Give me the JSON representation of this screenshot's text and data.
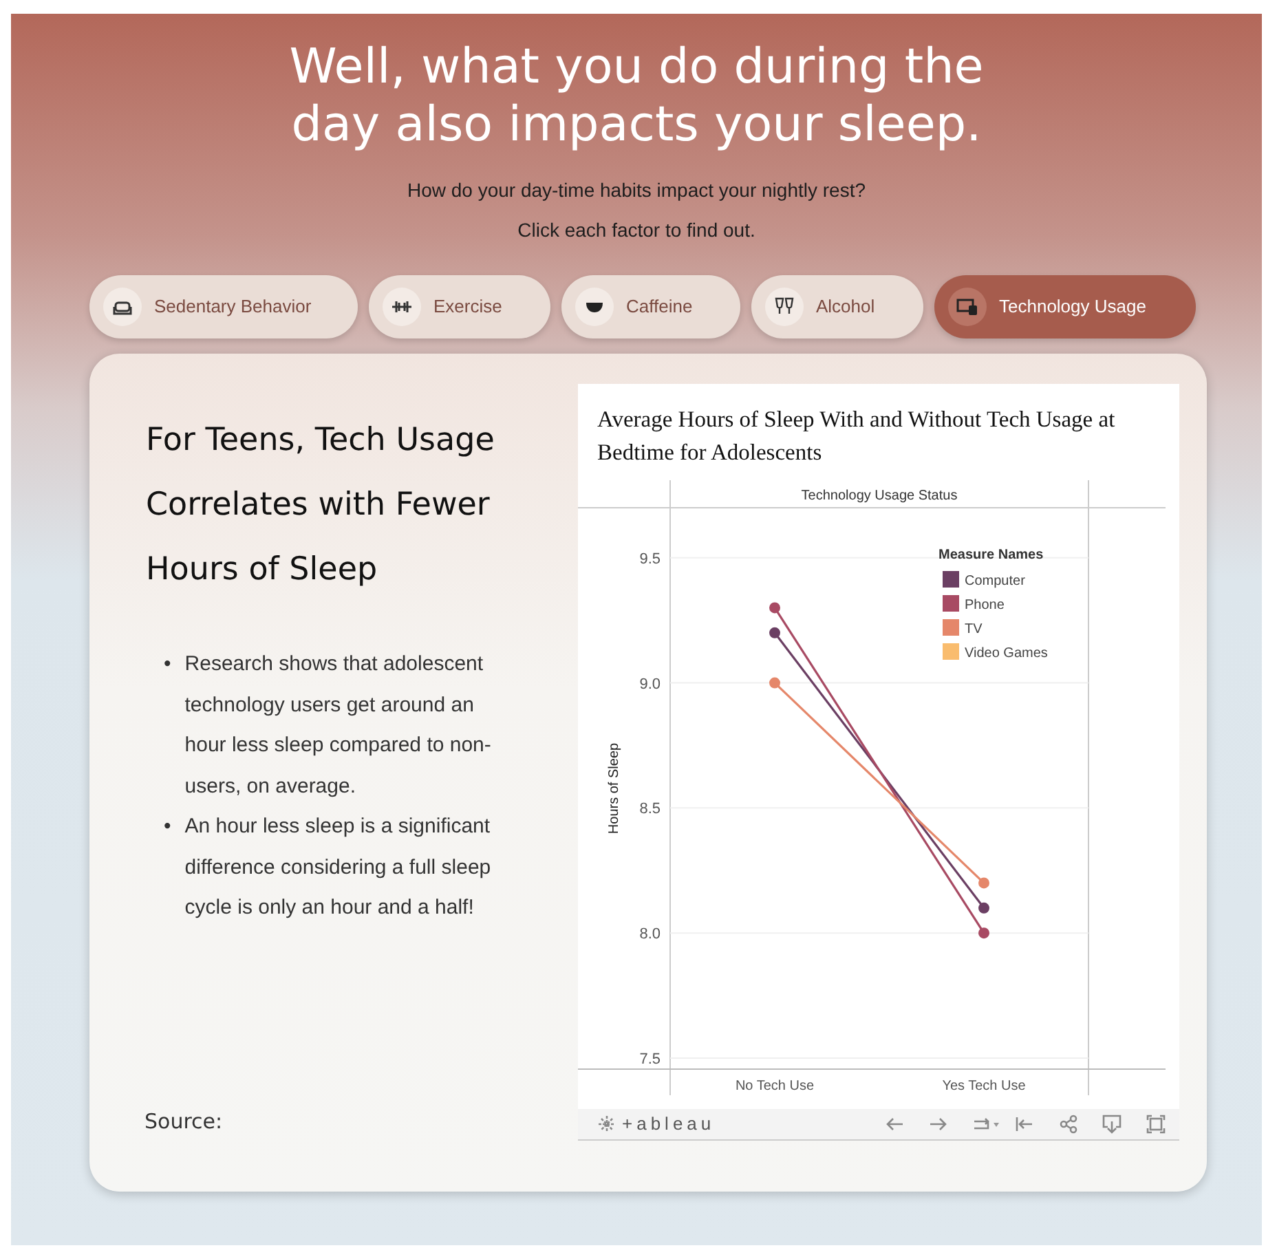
{
  "header": {
    "title": "Well, what you do during the day also impacts your sleep.",
    "subtitle": "How do your day-time habits impact your nightly rest?",
    "instruction": "Click each factor to find out."
  },
  "tabs": [
    {
      "label": "Sedentary Behavior",
      "selected": false
    },
    {
      "label": "Exercise",
      "selected": false
    },
    {
      "label": "Caffeine",
      "selected": false
    },
    {
      "label": "Alcohol",
      "selected": false
    },
    {
      "label": "Technology Usage",
      "selected": true
    }
  ],
  "panel": {
    "heading": "For Teens, Tech Usage Correlates with Fewer Hours of Sleep",
    "bullets": [
      {
        "marker": "•",
        "text": "Research shows that adolescent technology users get around an hour less sleep compared to non-users, on average."
      },
      {
        "marker": "•",
        "text": "An hour less sleep is a significant difference considering a full sleep cycle is only an hour and a half!"
      }
    ],
    "source": "Source:"
  },
  "viz": {
    "toolbar_logo": "+ableau",
    "chart_data": {
      "type": "line",
      "title": "Average Hours of Sleep With and Without Tech Usage at Bedtime for Adolescents",
      "xlabel": "Technology Usage Status",
      "ylabel": "Hours of Sleep",
      "categories": [
        "No Tech Use",
        "Yes Tech Use"
      ],
      "series": [
        {
          "name": "Computer",
          "color": "#6b3f63",
          "marker": "circle",
          "values": [
            9.2,
            8.1
          ]
        },
        {
          "name": "Phone",
          "color": "#a84a63",
          "marker": "circle",
          "values": [
            9.3,
            8.0
          ]
        },
        {
          "name": "TV",
          "color": "#e5876a",
          "marker": "circle",
          "values": [
            9.0,
            8.2
          ]
        },
        {
          "name": "Video Games",
          "color": "#f9bc6e",
          "values": [
            null,
            null
          ]
        }
      ],
      "grid": true,
      "legend": {
        "title": "Measure Names"
      },
      "ylim": [
        7.5,
        9.7
      ],
      "yticks": [
        {
          "value": 7.5,
          "label": "7.5"
        },
        {
          "value": 8,
          "label": "8.0"
        },
        {
          "value": 8.5,
          "label": "8.5"
        },
        {
          "value": 9,
          "label": "9.0"
        },
        {
          "value": 9.5,
          "label": "9.5"
        }
      ]
    }
  }
}
